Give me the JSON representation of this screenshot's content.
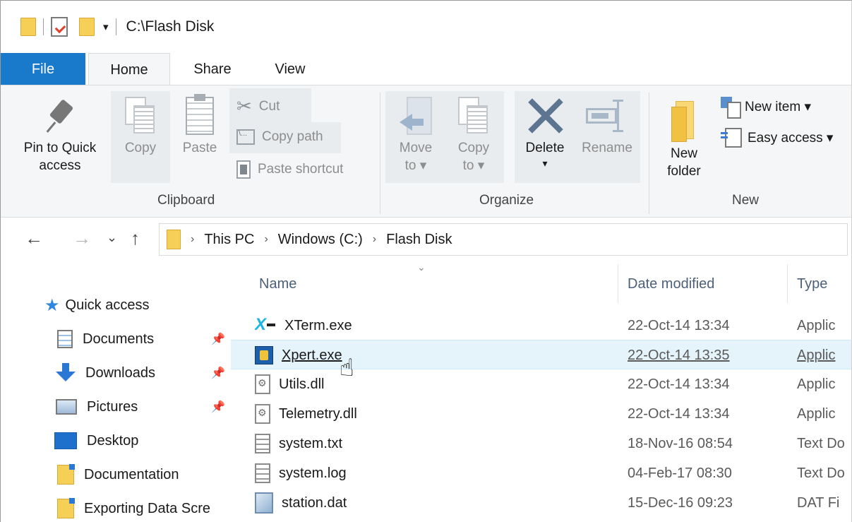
{
  "titlebar": {
    "path": "C:\\Flash Disk"
  },
  "tabs": {
    "file": "File",
    "home": "Home",
    "share": "Share",
    "view": "View"
  },
  "ribbon": {
    "clipboard": {
      "group_label": "Clipboard",
      "pin_line1": "Pin to Quick",
      "pin_line2": "access",
      "copy": "Copy",
      "paste": "Paste",
      "cut": "Cut",
      "copy_path": "Copy path",
      "paste_shortcut": "Paste shortcut"
    },
    "organize": {
      "group_label": "Organize",
      "move_line1": "Move",
      "move_line2": "to ▾",
      "copy_line1": "Copy",
      "copy_line2": "to ▾",
      "delete": "Delete",
      "delete_arrow": "▾",
      "rename": "Rename"
    },
    "new": {
      "group_label": "New",
      "new_folder_line1": "New",
      "new_folder_line2": "folder",
      "new_item": "New item ▾",
      "easy_access": "Easy access ▾"
    }
  },
  "address": {
    "crumbs": [
      "This PC",
      "Windows (C:)",
      "Flash Disk"
    ],
    "separator": "›",
    "back": "←",
    "forward": "→",
    "recent": "⌄",
    "up": "↑"
  },
  "navpane": {
    "quick_access": "Quick access",
    "items": [
      {
        "label": "Documents",
        "pinned": true
      },
      {
        "label": "Downloads",
        "pinned": true
      },
      {
        "label": "Pictures",
        "pinned": true
      },
      {
        "label": "Desktop",
        "pinned": false
      },
      {
        "label": "Documentation",
        "pinned": false
      },
      {
        "label": "Exporting Data Scre",
        "pinned": false
      }
    ],
    "pin_glyph": "📌"
  },
  "filelist": {
    "columns": {
      "name": "Name",
      "date": "Date modified",
      "type": "Type"
    },
    "sort_glyph": "⌄",
    "rows": [
      {
        "name": "XTerm.exe",
        "date": "22-Oct-14 13:34",
        "type": "Applic",
        "icon": "xterm-icon"
      },
      {
        "name": "Xpert.exe",
        "date": "22-Oct-14 13:35",
        "type": "Applic",
        "icon": "xpert-icon",
        "selected": true
      },
      {
        "name": "Utils.dll",
        "date": "22-Oct-14 13:34",
        "type": "Applic",
        "icon": "dll-icon"
      },
      {
        "name": "Telemetry.dll",
        "date": "22-Oct-14 13:34",
        "type": "Applic",
        "icon": "dll-icon"
      },
      {
        "name": "system.txt",
        "date": "18-Nov-16 08:54",
        "type": "Text Do",
        "icon": "text-file-icon"
      },
      {
        "name": "system.log",
        "date": "04-Feb-17 08:30",
        "type": "Text Do",
        "icon": "text-file-icon"
      },
      {
        "name": "station.dat",
        "date": "15-Dec-16 09:23",
        "type": "DAT Fi",
        "icon": "dat-file-icon"
      }
    ]
  },
  "colors": {
    "file_tab": "#1979ca",
    "selection": "#e5f3fb",
    "ribbon_bg": "#f5f6f7"
  }
}
